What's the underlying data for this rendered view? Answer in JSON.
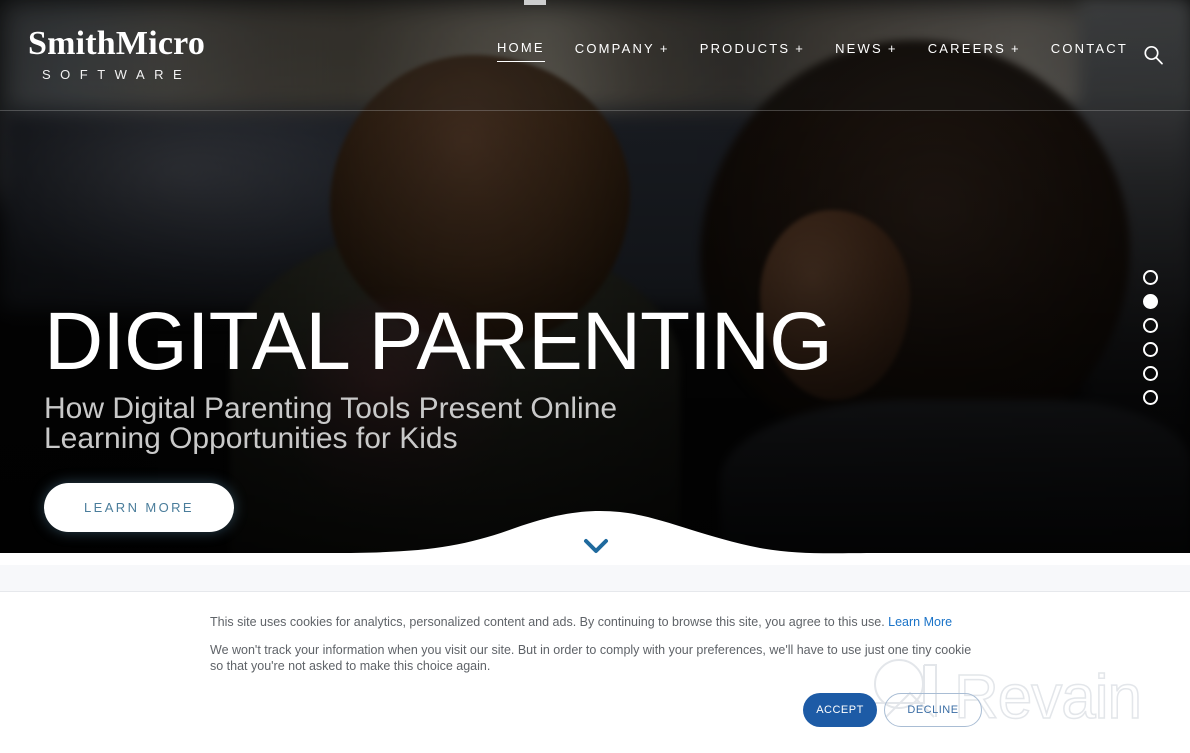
{
  "brand": {
    "logo_primary": "SmithMicro",
    "logo_primary_small": "S",
    "logo_primary_small2": "M",
    "logo_secondary": "SOFTWARE"
  },
  "nav": {
    "items": [
      {
        "label": "HOME",
        "plus": "",
        "active": true
      },
      {
        "label": "COMPANY",
        "plus": "+",
        "active": false
      },
      {
        "label": "PRODUCTS",
        "plus": "+",
        "active": false
      },
      {
        "label": "NEWS",
        "plus": "+",
        "active": false
      },
      {
        "label": "CAREERS",
        "plus": "+",
        "active": false
      },
      {
        "label": "CONTACT",
        "plus": "",
        "active": false
      }
    ],
    "search_icon": "search-icon"
  },
  "hero": {
    "headline": "DIGITAL PARENTING",
    "subhead_line1": "How Digital Parenting Tools Present Online",
    "subhead_line2": "Learning Opportunities for Kids",
    "cta_label": "LEARN MORE",
    "scroll_icon": "chevron-down-icon",
    "slides_total": 6,
    "slide_active_index": 2
  },
  "cookie": {
    "line1_text": "This site uses cookies for analytics, personalized content and ads. By continuing to browse this site, you agree to this use. ",
    "line1_link": "Learn More",
    "line2_text": "We won't track your information when you visit our site. But in order to comply with your preferences, we'll have to use just one tiny cookie so that you're not asked to make this choice again.",
    "accept_label": "ACCEPT",
    "decline_label": "DECLINE"
  },
  "watermark": {
    "text": "Revain",
    "mark": "revain-logo-icon"
  },
  "colors": {
    "accent_blue": "#1d5ba6",
    "link_blue": "#1a73c8",
    "cta_text_blue": "#4a7d9b",
    "decline_border": "#a9bdd4",
    "subhead_gray": "#c9c9c9",
    "body_gray": "#5f6368",
    "watermark_gray": "#e3e6ea"
  }
}
